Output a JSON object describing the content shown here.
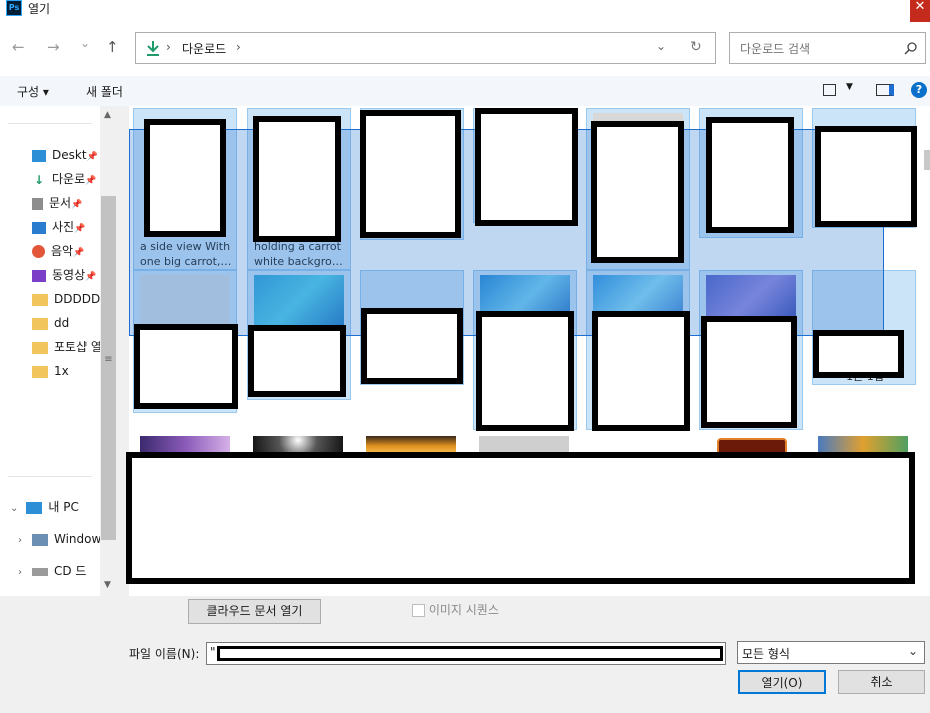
{
  "window": {
    "title": "열기",
    "app_badge": "Ps",
    "close_glyph": "✕"
  },
  "nav": {
    "back": "←",
    "forward": "→",
    "recent": "⌄",
    "up": "↑",
    "address_crumbs": [
      "다운로드"
    ],
    "address_sep": "›",
    "search_placeholder": "다운로드 검색"
  },
  "commands": {
    "organize": "구성 ▾",
    "new_folder": "새 폴더",
    "help": "?"
  },
  "sidebar": {
    "items": [
      {
        "label": "Deskt",
        "icon": "desktop-icon",
        "pinned": true
      },
      {
        "label": "다운로",
        "icon": "download-icon",
        "pinned": true
      },
      {
        "label": "문서",
        "icon": "document-icon",
        "pinned": true
      },
      {
        "label": "사진",
        "icon": "picture-icon",
        "pinned": true
      },
      {
        "label": "음악",
        "icon": "music-icon",
        "pinned": true
      },
      {
        "label": "동영상",
        "icon": "video-icon",
        "pinned": true
      },
      {
        "label": "DDDDD",
        "icon": "folder-icon",
        "pinned": false
      },
      {
        "label": "dd",
        "icon": "folder-icon",
        "pinned": false
      },
      {
        "label": "포토샵 열",
        "icon": "folder-icon",
        "pinned": false
      },
      {
        "label": "1x",
        "icon": "folder-icon",
        "pinned": false
      }
    ],
    "this_pc": "내 PC",
    "windows": "Window",
    "cd_drive": "CD 드"
  },
  "files": {
    "row1_captions": [
      [
        "a side view With",
        "one big carrot, ..."
      ],
      [
        "holding a carrot",
        "white backgrou..."
      ]
    ],
    "row2_partial_caption": "1는 1입"
  },
  "bottom": {
    "cloud_button": "클라우드 문서 열기",
    "image_sequence": "이미지 시퀀스",
    "filename_label": "파일 이름(N):",
    "filename_value": "\"",
    "filetype_value": "모든 형식",
    "open_button": "열기(O)",
    "cancel_button": "취소"
  },
  "colors": {
    "selection": "#cce4f7",
    "selection_border": "#99c9ef",
    "marquee": "#1c6ed2",
    "accent": "#0078d7"
  }
}
